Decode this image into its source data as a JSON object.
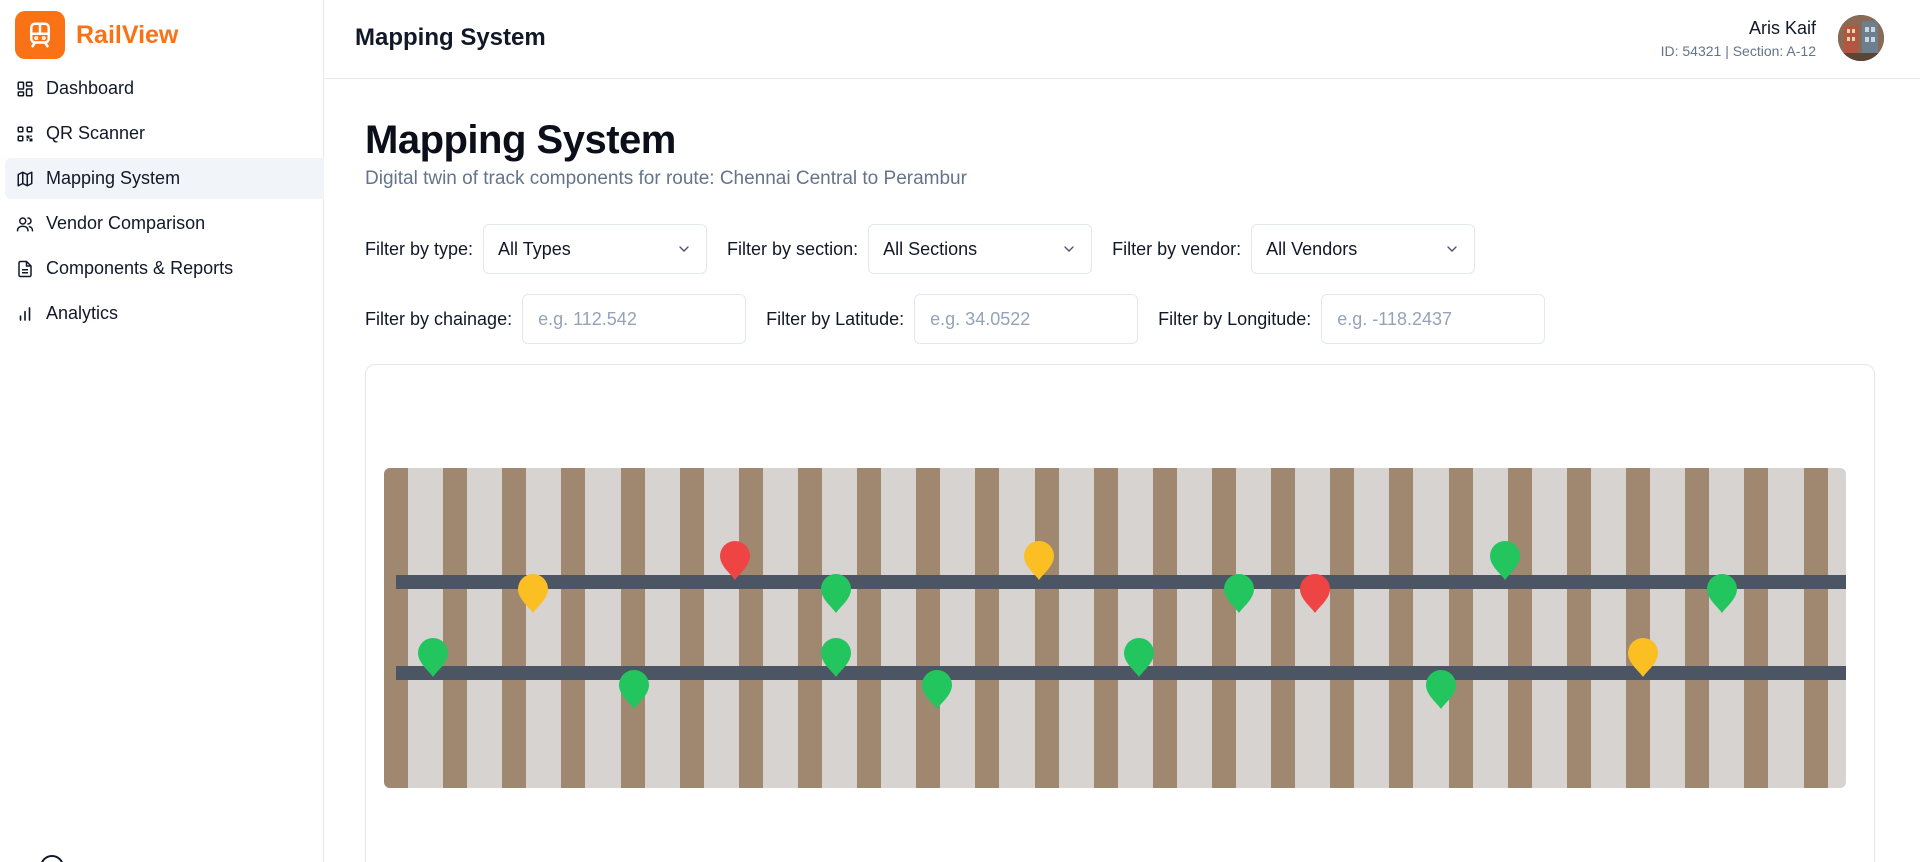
{
  "app": {
    "name": "RailView",
    "logo_icon": "train-icon",
    "accent": "#f97316"
  },
  "sidebar": {
    "items": [
      {
        "label": "Dashboard",
        "icon": "dashboard-icon",
        "active": false
      },
      {
        "label": "QR Scanner",
        "icon": "qr-icon",
        "active": false
      },
      {
        "label": "Mapping System",
        "icon": "map-icon",
        "active": true
      },
      {
        "label": "Vendor Comparison",
        "icon": "users-icon",
        "active": false
      },
      {
        "label": "Components & Reports",
        "icon": "document-icon",
        "active": false
      },
      {
        "label": "Analytics",
        "icon": "bar-chart-icon",
        "active": false
      }
    ]
  },
  "header": {
    "title": "Mapping System",
    "user": {
      "name": "Aris Kaif",
      "meta": "ID: 54321 | Section: A-12"
    }
  },
  "page": {
    "title": "Mapping System",
    "subtitle": "Digital twin of track components for route: Chennai Central to Perambur"
  },
  "filters": {
    "type": {
      "label": "Filter by type:",
      "value": "All Types"
    },
    "section": {
      "label": "Filter by section:",
      "value": "All Sections"
    },
    "vendor": {
      "label": "Filter by vendor:",
      "value": "All Vendors"
    },
    "chainage": {
      "label": "Filter by chainage:",
      "placeholder": "e.g. 112.542"
    },
    "latitude": {
      "label": "Filter by Latitude:",
      "placeholder": "e.g. 34.0522"
    },
    "longitude": {
      "label": "Filter by Longitude:",
      "placeholder": "e.g. -118.2437"
    }
  },
  "map": {
    "colors": {
      "ok": "#22c55e",
      "warning": "#fbbf24",
      "critical": "#ef4444",
      "sleeper": "#a08770",
      "ballast": "#d6d3d1",
      "rail": "#4b5563"
    },
    "markers": [
      {
        "status": "ok"
      },
      {
        "status": "warning"
      },
      {
        "status": "ok"
      },
      {
        "status": "critical"
      },
      {
        "status": "ok"
      },
      {
        "status": "ok"
      },
      {
        "status": "ok"
      },
      {
        "status": "warning"
      },
      {
        "status": "ok"
      },
      {
        "status": "ok"
      },
      {
        "status": "critical"
      },
      {
        "status": "ok"
      },
      {
        "status": "ok"
      },
      {
        "status": "warning"
      },
      {
        "status": "ok"
      }
    ]
  }
}
